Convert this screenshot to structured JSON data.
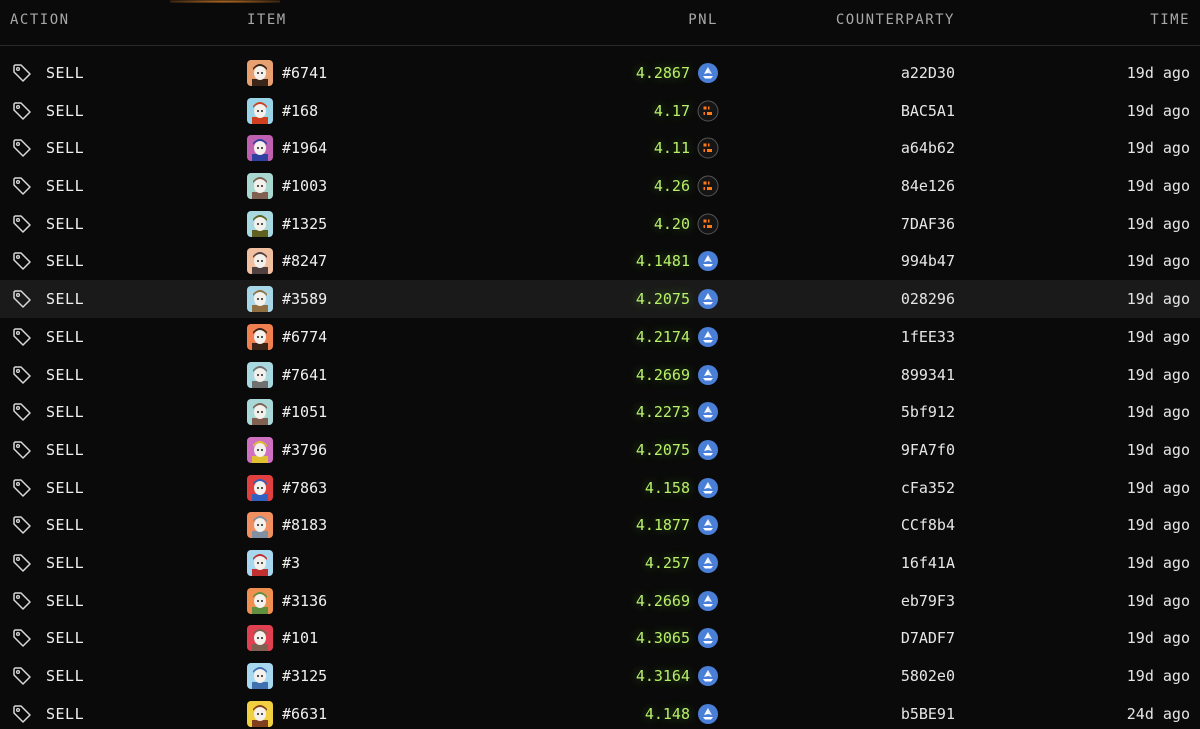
{
  "header": {
    "action": "ACTION",
    "item": "ITEM",
    "pnl": "PNL",
    "counterparty": "COUNTERPARTY",
    "time": "TIME"
  },
  "colors": {
    "pnl_green": "#b8f06a",
    "token_blue": "#4a7fd8",
    "token_blur_orange": "#ff7a1a"
  },
  "rows": [
    {
      "action": "SELL",
      "item": "#6741",
      "pnl": "4.2867",
      "token": "blue",
      "counterparty": "a22D30",
      "time": "19d ago",
      "avatar_bg": "#e8a070",
      "avatar_face": "#3a2518"
    },
    {
      "action": "SELL",
      "item": "#168",
      "pnl": "4.17",
      "token": "blur",
      "counterparty": "BAC5A1",
      "time": "19d ago",
      "avatar_bg": "#9ad4e8",
      "avatar_face": "#d04020"
    },
    {
      "action": "SELL",
      "item": "#1964",
      "pnl": "4.11",
      "token": "blur",
      "counterparty": "a64b62",
      "time": "19d ago",
      "avatar_bg": "#c060b0",
      "avatar_face": "#3040a0"
    },
    {
      "action": "SELL",
      "item": "#1003",
      "pnl": "4.26",
      "token": "blur",
      "counterparty": "84e126",
      "time": "19d ago",
      "avatar_bg": "#a8d8d0",
      "avatar_face": "#806050"
    },
    {
      "action": "SELL",
      "item": "#1325",
      "pnl": "4.20",
      "token": "blur",
      "counterparty": "7DAF36",
      "time": "19d ago",
      "avatar_bg": "#a8d8e0",
      "avatar_face": "#606020"
    },
    {
      "action": "SELL",
      "item": "#8247",
      "pnl": "4.1481",
      "token": "blue",
      "counterparty": "994b47",
      "time": "19d ago",
      "avatar_bg": "#f0c0a0",
      "avatar_face": "#504040"
    },
    {
      "action": "SELL",
      "item": "#3589",
      "pnl": "4.2075",
      "token": "blue",
      "counterparty": "028296",
      "time": "19d ago",
      "avatar_bg": "#a8d8e8",
      "avatar_face": "#907040",
      "highlight": true
    },
    {
      "action": "SELL",
      "item": "#6774",
      "pnl": "4.2174",
      "token": "blue",
      "counterparty": "1fEE33",
      "time": "19d ago",
      "avatar_bg": "#f08050",
      "avatar_face": "#3a2518"
    },
    {
      "action": "SELL",
      "item": "#7641",
      "pnl": "4.2669",
      "token": "blue",
      "counterparty": "899341",
      "time": "19d ago",
      "avatar_bg": "#a8d8e0",
      "avatar_face": "#707070"
    },
    {
      "action": "SELL",
      "item": "#1051",
      "pnl": "4.2273",
      "token": "blue",
      "counterparty": "5bf912",
      "time": "19d ago",
      "avatar_bg": "#a8d8d8",
      "avatar_face": "#806050"
    },
    {
      "action": "SELL",
      "item": "#3796",
      "pnl": "4.2075",
      "token": "blue",
      "counterparty": "9FA7f0",
      "time": "19d ago",
      "avatar_bg": "#d070c0",
      "avatar_face": "#e0c030"
    },
    {
      "action": "SELL",
      "item": "#7863",
      "pnl": "4.158",
      "token": "blue",
      "counterparty": "cFa352",
      "time": "19d ago",
      "avatar_bg": "#e04040",
      "avatar_face": "#3060c0"
    },
    {
      "action": "SELL",
      "item": "#8183",
      "pnl": "4.1877",
      "token": "blue",
      "counterparty": "CCf8b4",
      "time": "19d ago",
      "avatar_bg": "#f09060",
      "avatar_face": "#8090a0"
    },
    {
      "action": "SELL",
      "item": "#3",
      "pnl": "4.257",
      "token": "blue",
      "counterparty": "16f41A",
      "time": "19d ago",
      "avatar_bg": "#a8d8f0",
      "avatar_face": "#c03030"
    },
    {
      "action": "SELL",
      "item": "#3136",
      "pnl": "4.2669",
      "token": "blue",
      "counterparty": "eb79F3",
      "time": "19d ago",
      "avatar_bg": "#f09050",
      "avatar_face": "#609040"
    },
    {
      "action": "SELL",
      "item": "#101",
      "pnl": "4.3065",
      "token": "blue",
      "counterparty": "D7ADF7",
      "time": "19d ago",
      "avatar_bg": "#e04050",
      "avatar_face": "#806050"
    },
    {
      "action": "SELL",
      "item": "#3125",
      "pnl": "4.3164",
      "token": "blue",
      "counterparty": "5802e0",
      "time": "19d ago",
      "avatar_bg": "#a8d8f0",
      "avatar_face": "#4070b0"
    },
    {
      "action": "SELL",
      "item": "#6631",
      "pnl": "4.148",
      "token": "blue",
      "counterparty": "b5BE91",
      "time": "24d ago",
      "avatar_bg": "#f0d040",
      "avatar_face": "#804020"
    }
  ]
}
